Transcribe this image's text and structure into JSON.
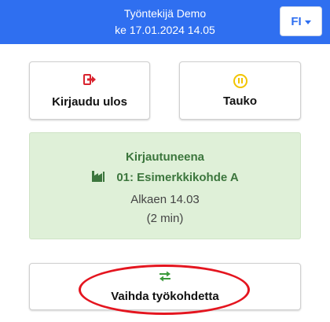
{
  "header": {
    "user_name": "Työntekijä Demo",
    "datetime": "ke 17.01.2024 14.05",
    "language": "FI"
  },
  "actions": {
    "logout_label": "Kirjaudu ulos",
    "pause_label": "Tauko",
    "change_site_label": "Vaihda työkohdetta"
  },
  "status": {
    "title": "Kirjautuneena",
    "site": "01: Esimerkkikohde A",
    "since": "Alkaen 14.03",
    "duration": "(2 min)"
  },
  "icons": {
    "logout": "sign-out-icon",
    "pause": "pause-circle-icon",
    "site": "factory-icon",
    "change": "swap-arrows-icon",
    "language_caret": "caret-down-icon"
  },
  "colors": {
    "header_bg": "#2f6ff0",
    "logout_icon": "#d9232e",
    "pause_icon": "#f2c400",
    "status_bg": "#dff0d8",
    "status_text": "#3c763d",
    "change_icon": "#3c9a3c",
    "annotation": "#e4151f"
  }
}
